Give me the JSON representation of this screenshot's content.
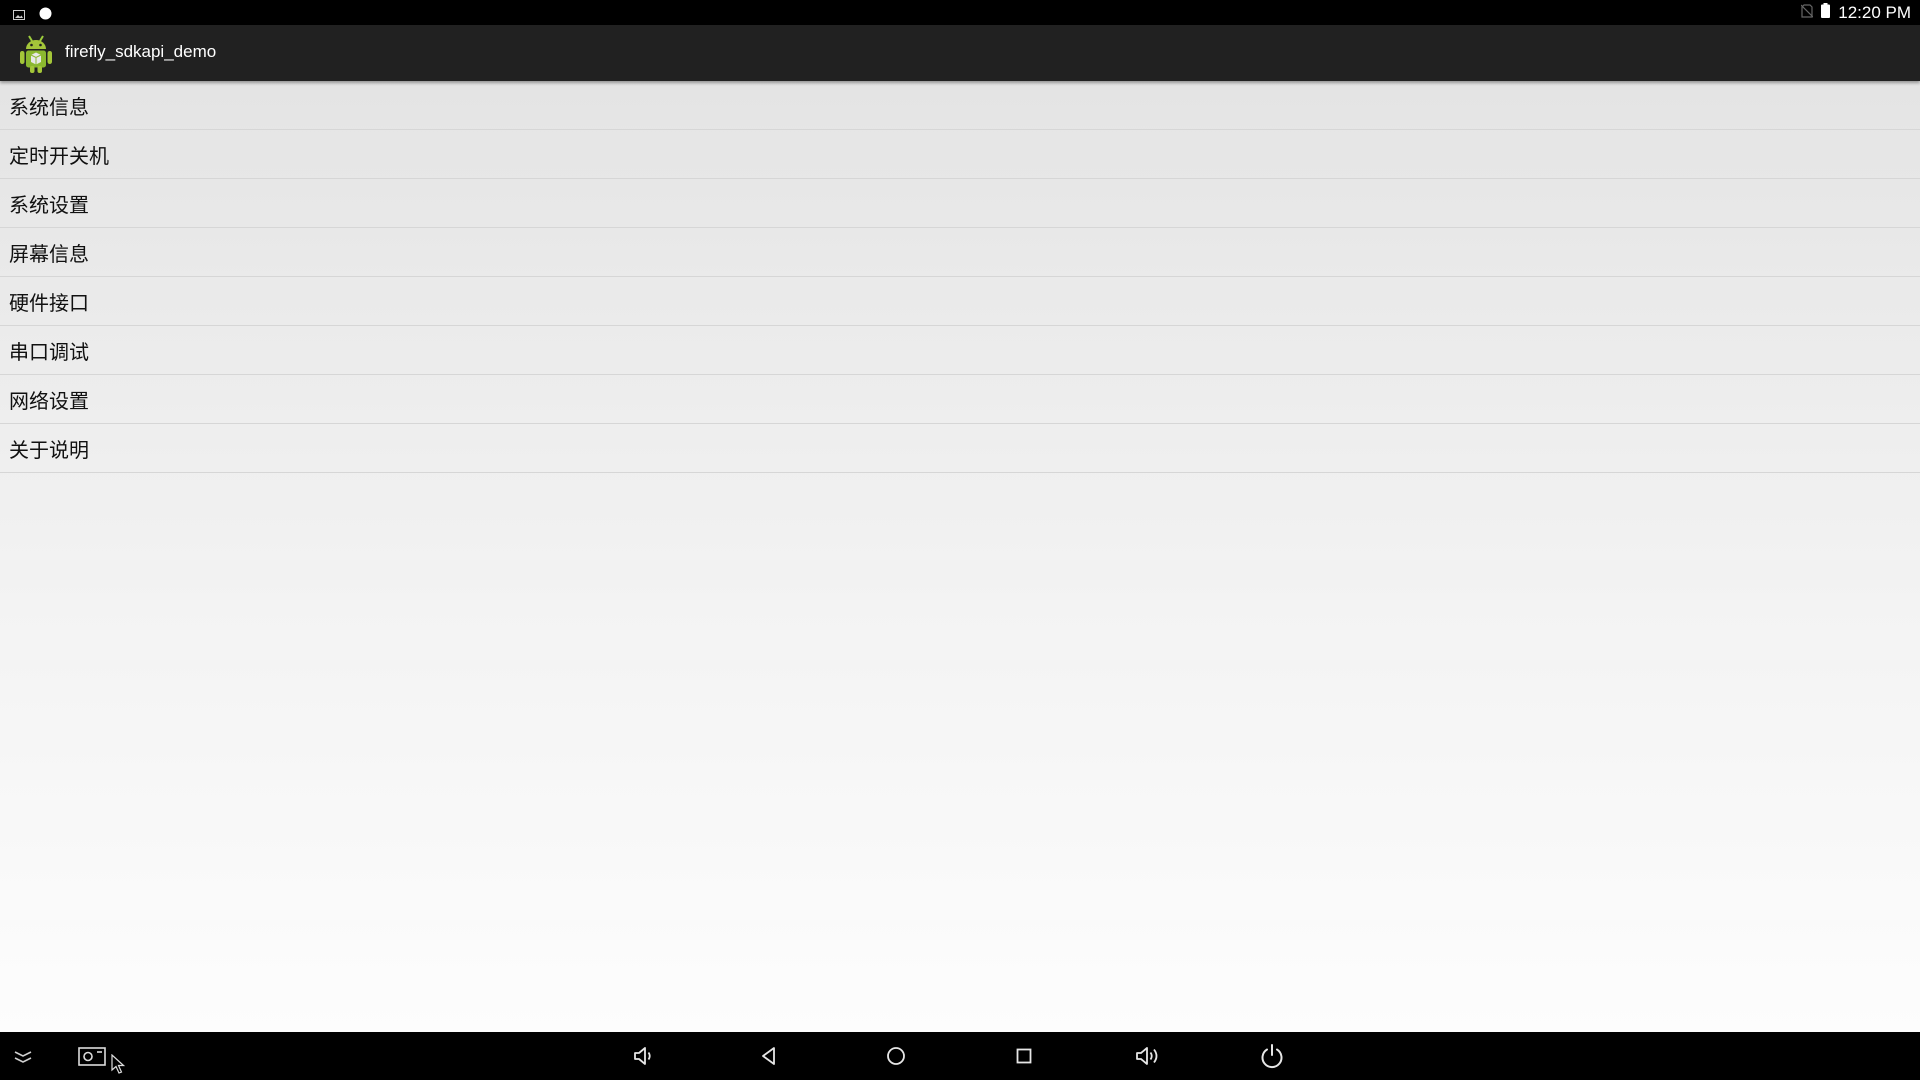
{
  "status_bar": {
    "time": "12:20 PM",
    "left_icons": [
      "gallery-notification-icon",
      "circle-notification-icon"
    ],
    "right_icons": [
      "no-sim-icon",
      "battery-icon"
    ]
  },
  "app_bar": {
    "title": "firefly_sdkapi_demo",
    "icon": "android-app-icon"
  },
  "menu": {
    "items": [
      {
        "label": "系统信息"
      },
      {
        "label": "定时开关机"
      },
      {
        "label": "系统设置"
      },
      {
        "label": "屏幕信息"
      },
      {
        "label": "硬件接口"
      },
      {
        "label": "串口调试"
      },
      {
        "label": "网络设置"
      },
      {
        "label": "关于说明"
      }
    ]
  },
  "nav_bar": {
    "buttons": [
      "collapse-icon",
      "screenshot-icon",
      "volume-down-icon",
      "back-icon",
      "home-icon",
      "recents-icon",
      "volume-up-icon",
      "power-icon"
    ]
  },
  "colors": {
    "action_bar": "#212121",
    "status_bar": "#000000",
    "android_green": "#8bc34a"
  }
}
